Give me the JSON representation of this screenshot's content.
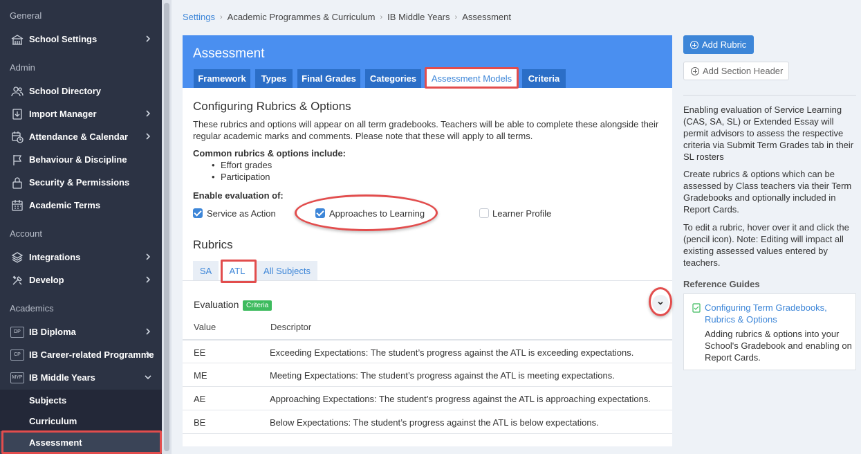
{
  "sidebar": {
    "sections": {
      "general": "General",
      "admin": "Admin",
      "account": "Account",
      "academics": "Academics"
    },
    "items": {
      "school_settings": "School Settings",
      "school_directory": "School Directory",
      "import_manager": "Import Manager",
      "attendance": "Attendance & Calendar",
      "behaviour": "Behaviour & Discipline",
      "security": "Security & Permissions",
      "academic_terms": "Academic Terms",
      "integrations": "Integrations",
      "develop": "Develop",
      "ib_diploma": "IB Diploma",
      "ib_career": "IB Career-related Programme",
      "ib_myp": "IB Middle Years"
    },
    "badges": {
      "dp": "DP",
      "cp": "CP",
      "myp": "MYP"
    },
    "subitems": {
      "subjects": "Subjects",
      "curriculum": "Curriculum",
      "assessment": "Assessment"
    }
  },
  "breadcrumb": [
    "Settings",
    "Academic Programmes & Curriculum",
    "IB Middle Years",
    "Assessment"
  ],
  "card": {
    "title": "Assessment",
    "tabs": [
      "Framework",
      "Types",
      "Final Grades",
      "Categories",
      "Assessment Models",
      "Criteria"
    ],
    "active_tab": "Assessment Models"
  },
  "config": {
    "heading": "Configuring Rubrics & Options",
    "desc_line1": "These rubrics and options will appear on all term gradebooks. Teachers will be able to complete these alongside their",
    "desc_line2": "regular academic marks and comments. Please note that these will apply to all terms.",
    "common_label": "Common rubrics & options include:",
    "common_items": [
      "Effort grades",
      "Participation"
    ],
    "enable_label": "Enable evaluation of:",
    "checkboxes": [
      {
        "label": "Service as Action",
        "checked": true
      },
      {
        "label": "Approaches to Learning",
        "checked": true
      },
      {
        "label": "Learner Profile",
        "checked": false
      }
    ]
  },
  "rubrics": {
    "heading": "Rubrics",
    "tabs": [
      "SA",
      "ATL",
      "All Subjects"
    ],
    "active_tab": "ATL",
    "evaluation_title": "Evaluation",
    "evaluation_badge": "Criteria",
    "columns": [
      "Value",
      "Descriptor"
    ],
    "rows": [
      {
        "value": "EE",
        "descriptor": "Exceeding Expectations: The student’s progress against the ATL is exceeding expectations."
      },
      {
        "value": "ME",
        "descriptor": "Meeting Expectations: The student’s progress against the ATL is meeting expectations."
      },
      {
        "value": "AE",
        "descriptor": "Approaching Expectations: The student’s progress against the ATL is approaching expectations."
      },
      {
        "value": "BE",
        "descriptor": "Below Expectations: The student’s progress against the ATL is below expectations."
      }
    ]
  },
  "right_panel": {
    "add_rubric": "Add Rubric",
    "add_section_header": "Add Section Header",
    "help_1": "Enabling evaluation of Service Learning (CAS, SA, SL) or Extended Essay will permit advisors to assess the respective criteria via Submit Term Grades tab in their SL rosters",
    "help_2": "Create rubrics & options which can be assessed by Class teachers via their Term Gradebooks and optionally included in Report Cards.",
    "help_3": "To edit a rubric, hover over it and click the (pencil icon). Note: Editing will impact all existing assessed values entered by teachers.",
    "reference_title": "Reference Guides",
    "guide_title": "Configuring Term Gradebooks, Rubrics & Options",
    "guide_desc": "Adding rubrics & options into your School's Gradebook and enabling on Report Cards."
  },
  "colors": {
    "sidebar_bg": "#2c3344",
    "primary": "#3d86d8",
    "header_blue": "#4a8ff0",
    "tab_blue": "#2b6ec7",
    "highlight_red": "#e24d4d",
    "badge_green": "#3dbb5e"
  }
}
